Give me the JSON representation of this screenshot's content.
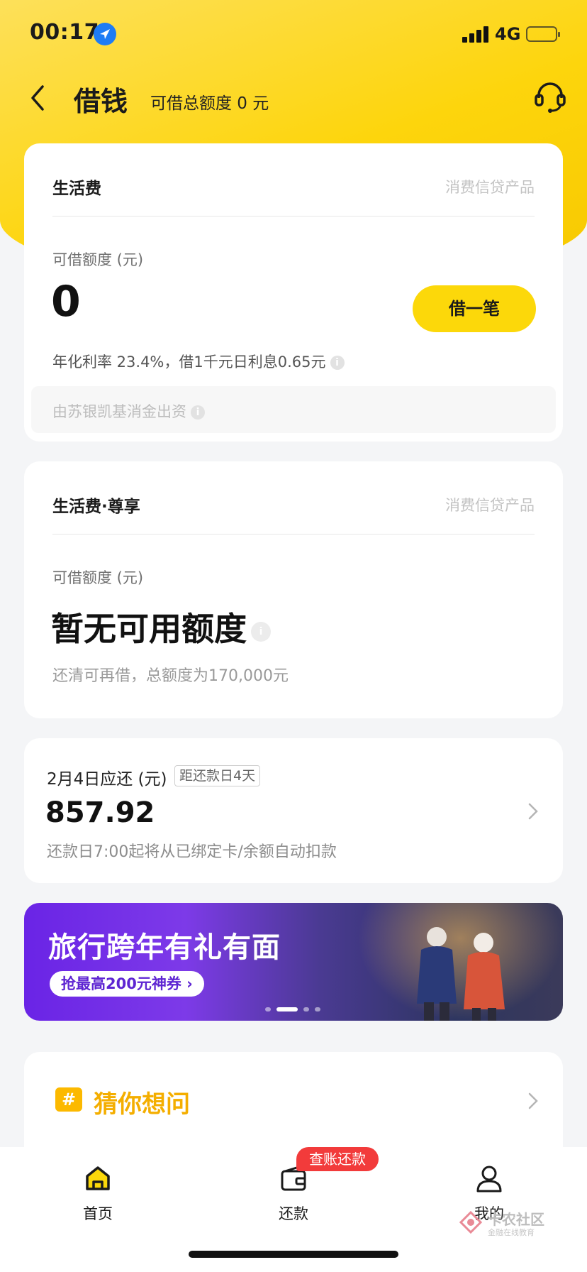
{
  "status_bar": {
    "time": "00:17",
    "network": "4G"
  },
  "nav": {
    "title": "借钱",
    "subtitle": "可借总额度 0 元"
  },
  "card_living": {
    "title": "生活费",
    "tag": "消费信贷产品",
    "limit_label": "可借额度 (元)",
    "amount": "0",
    "borrow_label": "借一笔",
    "rate_text": "年化利率 23.4%，借1千元日利息0.65元",
    "funder_text": "由苏银凯基消金出资"
  },
  "card_premium": {
    "title": "生活费·尊享",
    "tag": "消费信贷产品",
    "limit_label": "可借额度 (元)",
    "status": "暂无可用额度",
    "note": "还清可再借，总额度为170,000元"
  },
  "repay_card": {
    "title": "2月4日应还 (元)",
    "badge": "距还款日4天",
    "amount": "857.92",
    "note": "还款日7:00起将从已绑定卡/余额自动扣款"
  },
  "banner": {
    "title": "旅行跨年有礼有面",
    "pill": "抢最高200元神券 ›",
    "page_count": 4,
    "active_page": 1
  },
  "guess_card": {
    "icon_char": "#",
    "title": "猜你想问"
  },
  "tabbar": {
    "tabs": [
      {
        "label": "首页",
        "icon": "home-icon"
      },
      {
        "label": "还款",
        "icon": "wallet-icon"
      },
      {
        "label": "我的",
        "icon": "user-icon"
      }
    ],
    "badge": "查账还款"
  },
  "watermark": {
    "main": "卡农社区",
    "sub": "金融在线教育"
  },
  "colors": {
    "brand_yellow": "#fcd80a",
    "badge_red": "#f23b3b",
    "banner_purple": "#6a24e6",
    "guess_orange": "#f4ae00"
  }
}
